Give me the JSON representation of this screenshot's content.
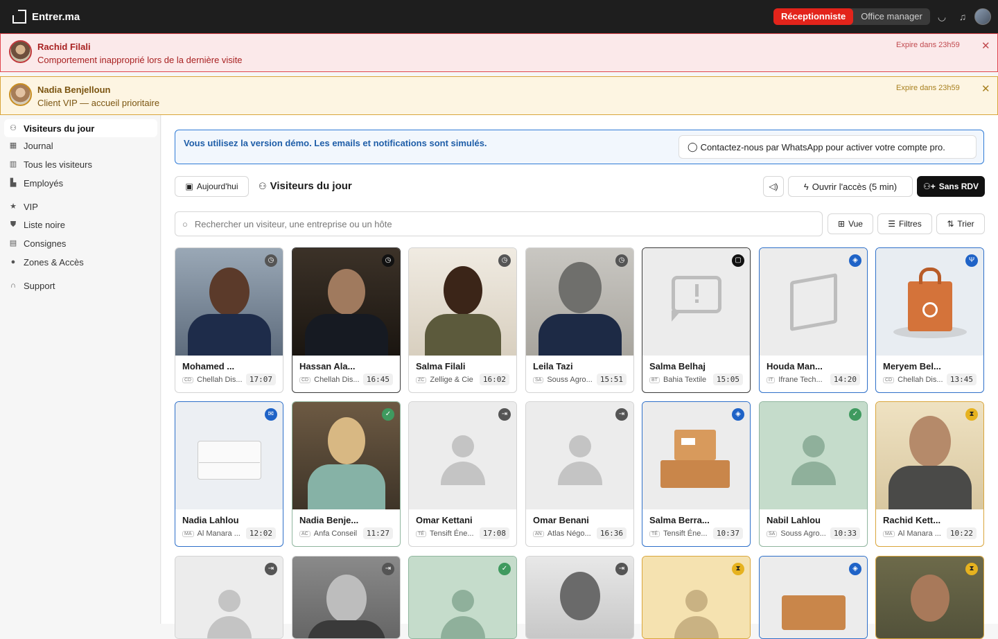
{
  "app": {
    "name": "Entrer.ma",
    "roles": [
      "Réceptionniste",
      "Office manager"
    ]
  },
  "alerts": [
    {
      "name": "Rachid Filali",
      "message": "Comportement inapproprié lors de la dernière visite",
      "expires": "Expire dans 23h59"
    },
    {
      "name": "Nadia Benjelloun",
      "message": "Client VIP — accueil prioritaire",
      "expires": "Expire dans 23h59"
    }
  ],
  "sidebar": {
    "items": [
      "Visiteurs du jour",
      "Journal",
      "Tous les visiteurs",
      "Employés",
      "VIP",
      "Liste noire",
      "Consignes",
      "Zones & Accès",
      "Support"
    ]
  },
  "demo": {
    "text": "Vous utilisez la version démo. Les emails et notifications sont simulés.",
    "button": "Contactez-nous par WhatsApp pour activer votre compte pro."
  },
  "toolbar": {
    "today": "Aujourd'hui",
    "title": "Visiteurs du jour",
    "open_access": "Ouvrir l'accès (5 min)",
    "no_rdv": "Sans RDV"
  },
  "search": {
    "placeholder": "Rechercher un visiteur, une entreprise ou un hôte",
    "view": "Vue",
    "filters": "Filtres",
    "sort": "Trier"
  },
  "cards": [
    {
      "name": "Mohamed ...",
      "company": "Chellah Dis...",
      "tag": "CD",
      "time": "17:07"
    },
    {
      "name": "Hassan Ala...",
      "company": "Chellah Dis...",
      "tag": "CD",
      "time": "16:45"
    },
    {
      "name": "Salma Filali",
      "company": "Zellige & Cie",
      "tag": "ZC",
      "time": "16:02"
    },
    {
      "name": "Leila Tazi",
      "company": "Souss Agro...",
      "tag": "SA",
      "time": "15:51"
    },
    {
      "name": "Salma Belhaj",
      "company": "Bahia Textile",
      "tag": "BT",
      "time": "15:05"
    },
    {
      "name": "Houda Man...",
      "company": "Ifrane Tech...",
      "tag": "IT",
      "time": "14:20"
    },
    {
      "name": "Meryem Bel...",
      "company": "Chellah Dis...",
      "tag": "CD",
      "time": "13:45"
    },
    {
      "name": "Nadia Lahlou",
      "company": "Al Manara ...",
      "tag": "MA",
      "time": "12:02"
    },
    {
      "name": "Nadia Benje...",
      "company": "Anfa Conseil",
      "tag": "AC",
      "time": "11:27"
    },
    {
      "name": "Omar Kettani",
      "company": "Tensift Éne...",
      "tag": "TÉ",
      "time": "17:08"
    },
    {
      "name": "Omar Benani",
      "company": "Atlas Négo...",
      "tag": "AN",
      "time": "16:36"
    },
    {
      "name": "Salma Berra...",
      "company": "Tensift Éne...",
      "tag": "TÉ",
      "time": "10:37"
    },
    {
      "name": "Nabil Lahlou",
      "company": "Souss Agro...",
      "tag": "SA",
      "time": "10:33"
    },
    {
      "name": "Rachid Kett...",
      "company": "Al Manara ...",
      "tag": "MA",
      "time": "10:22"
    }
  ],
  "colors": {
    "accent": "#e3241b",
    "blue": "#1f63c7",
    "green": "#3f9a5f",
    "yellow": "#e6b21f"
  }
}
